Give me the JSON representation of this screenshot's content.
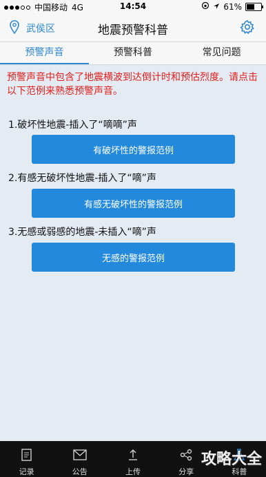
{
  "status_bar": {
    "carrier": "中国移动",
    "network": "4G",
    "time": "14:54",
    "battery_percent": "61%",
    "battery_level": 0.61
  },
  "nav": {
    "location": "武侯区",
    "title": "地震预警科普",
    "accent_color": "#2e88d0"
  },
  "tabs": [
    {
      "label": "预警声音",
      "active": true
    },
    {
      "label": "预警科普",
      "active": false
    },
    {
      "label": "常见问题",
      "active": false
    }
  ],
  "notice": "预警声音中包含了地震横波到达倒计时和预估烈度。请点击以下范例来熟悉预警声音。",
  "sections": [
    {
      "label": "1.破坏性地震-插入了“嘀嘀”声",
      "button": "有破坏性的警报范例"
    },
    {
      "label": "2.有感无破坏性地震-插入了“嘀”声",
      "button": "有感无破坏性的警报范例"
    },
    {
      "label": "3.无感或弱感的地震-未插入“嘀”声",
      "button": "无感的警报范例"
    }
  ],
  "bottom_nav": [
    {
      "label": "记录",
      "icon": "record-icon"
    },
    {
      "label": "公告",
      "icon": "notice-icon"
    },
    {
      "label": "上传",
      "icon": "upload-icon"
    },
    {
      "label": "分享",
      "icon": "share-icon"
    },
    {
      "label": "科普",
      "icon": "science-icon"
    }
  ],
  "watermark": "攻略大全"
}
